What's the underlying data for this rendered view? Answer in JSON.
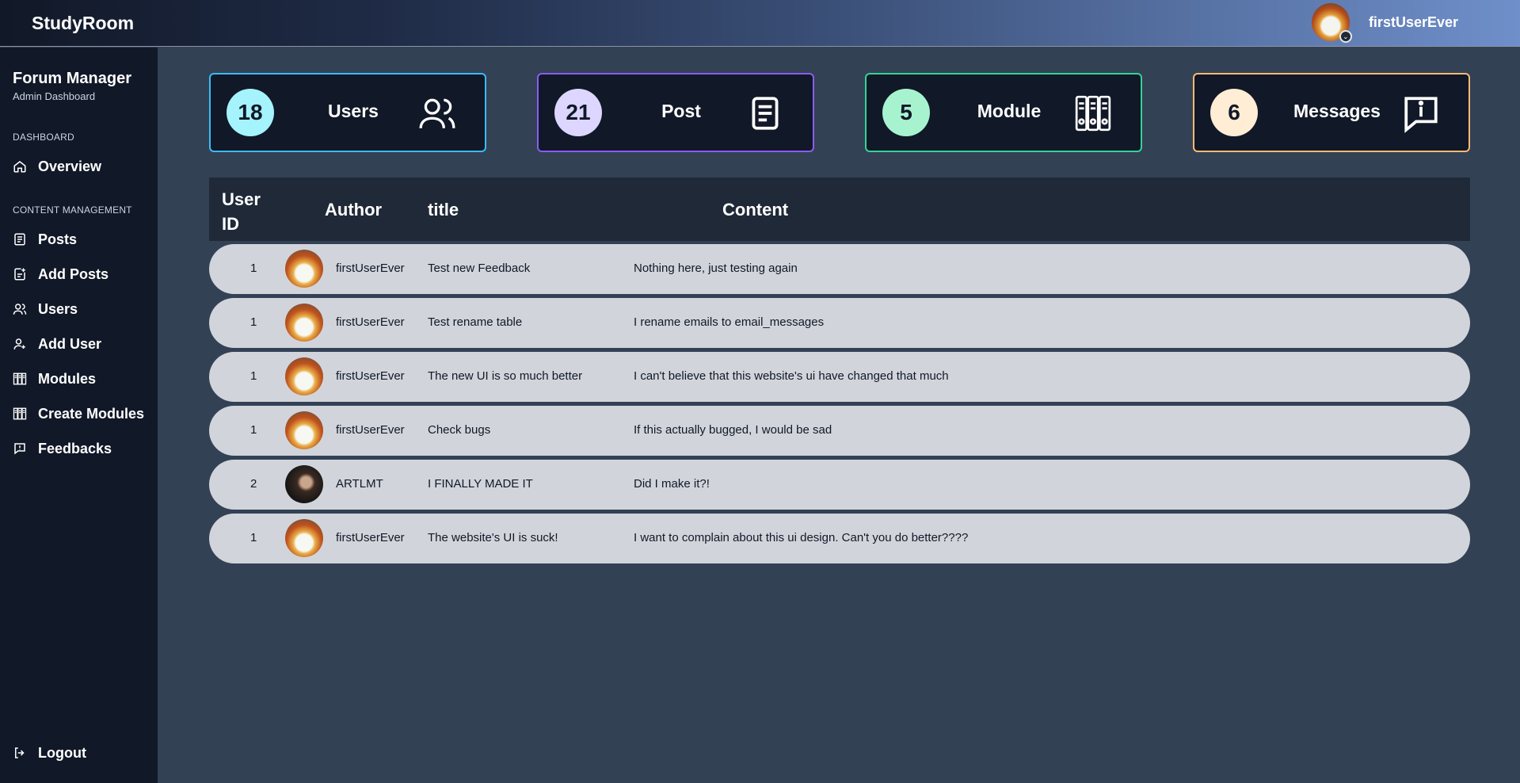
{
  "header": {
    "brand": "StudyRoom",
    "username": "firstUserEver"
  },
  "sidebar": {
    "title": "Forum Manager",
    "subtitle": "Admin Dashboard",
    "sections": {
      "dashboard": "DASHBOARD",
      "content": "CONTENT MANAGEMENT"
    },
    "items": [
      {
        "label": "Overview",
        "icon": "home-icon"
      },
      {
        "label": "Posts",
        "icon": "document-icon"
      },
      {
        "label": "Add Posts",
        "icon": "add-document-icon"
      },
      {
        "label": "Users",
        "icon": "users-icon"
      },
      {
        "label": "Add User",
        "icon": "add-user-icon"
      },
      {
        "label": "Modules",
        "icon": "binders-icon"
      },
      {
        "label": "Create Modules",
        "icon": "binders-icon"
      },
      {
        "label": "Feedbacks",
        "icon": "feedback-icon"
      }
    ],
    "logout": "Logout"
  },
  "stats": [
    {
      "value": "18",
      "label": "Users",
      "border": "#38bdf8",
      "circle": "#a5f3fc",
      "icon": "users-icon"
    },
    {
      "value": "21",
      "label": "Post",
      "border": "#8b5cf6",
      "circle": "#ddd6fe",
      "icon": "document-icon"
    },
    {
      "value": "5",
      "label": "Module",
      "border": "#34d399",
      "circle": "#a7f3d0",
      "icon": "binders-icon"
    },
    {
      "value": "6",
      "label": "Messages",
      "border": "#fdba74",
      "circle": "#ffedd5",
      "icon": "info-message-icon"
    }
  ],
  "table": {
    "headers": {
      "user_id": "User ID",
      "author": "Author",
      "title": "title",
      "content": "Content"
    },
    "rows": [
      {
        "user_id": "1",
        "author": "firstUserEver",
        "title": "Test new Feedback",
        "content": "Nothing here, just testing again"
      },
      {
        "user_id": "1",
        "author": "firstUserEver",
        "title": "Test rename table",
        "content": "I rename emails to email_messages"
      },
      {
        "user_id": "1",
        "author": "firstUserEver",
        "title": "The new UI is so much better",
        "content": "I can't believe that this website's ui have changed that much"
      },
      {
        "user_id": "1",
        "author": "firstUserEver",
        "title": "Check bugs",
        "content": "If this actually bugged, I would be sad"
      },
      {
        "user_id": "2",
        "author": "ARTLMT",
        "title": "I FINALLY MADE IT",
        "content": "Did I make it?!"
      },
      {
        "user_id": "1",
        "author": "firstUserEver",
        "title": "The website's UI is suck!",
        "content": "I want to complain about this ui design. Can't you do better????"
      }
    ]
  }
}
